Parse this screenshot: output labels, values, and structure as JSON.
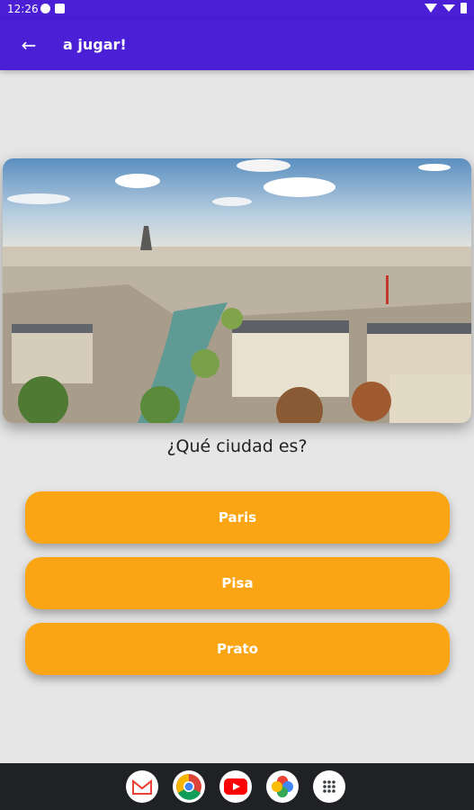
{
  "status": {
    "time": "12:26"
  },
  "app_bar": {
    "title": "a jugar!"
  },
  "quiz": {
    "question": "¿Qué ciudad es?",
    "options": [
      "Paris",
      "Pisa",
      "Prato"
    ]
  },
  "colors": {
    "primary": "#4a1fd6",
    "answer": "#fba515",
    "background": "#e6e6e6"
  },
  "dock": [
    "gmail-icon",
    "chrome-icon",
    "youtube-icon",
    "photos-icon",
    "apps-icon"
  ]
}
